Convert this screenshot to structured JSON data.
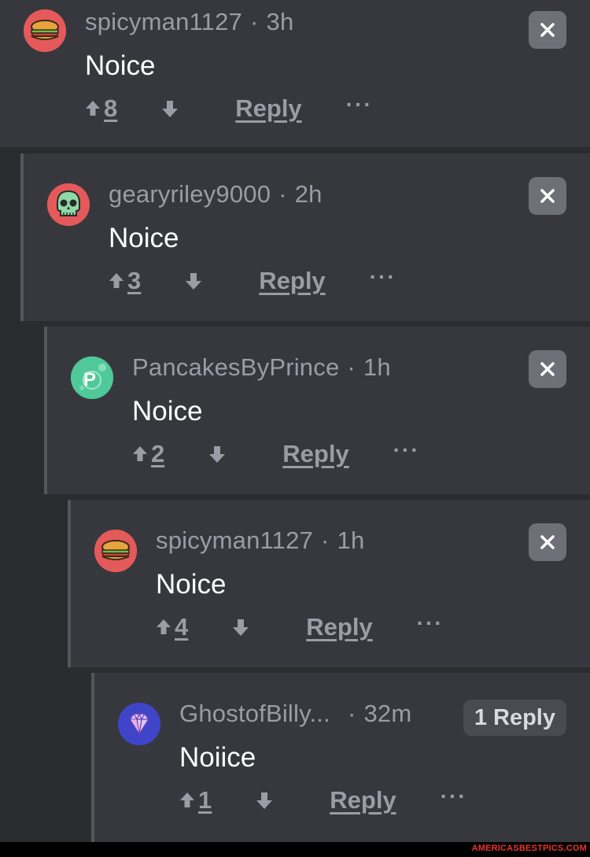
{
  "comments": [
    {
      "username": "spicyman1127",
      "time": "3h",
      "text": "Noice",
      "votes": "8",
      "reply_label": "Reply",
      "more_label": "···",
      "avatar": "sandwich-avatar",
      "avatar_bg": "#e45a5a"
    },
    {
      "username": "gearyriley9000",
      "time": "2h",
      "text": "Noice",
      "votes": "3",
      "reply_label": "Reply",
      "more_label": "···",
      "avatar": "skull-avatar",
      "avatar_bg": "#e45a5a"
    },
    {
      "username": "PancakesByPrince",
      "time": "1h",
      "text": "Noice",
      "votes": "2",
      "reply_label": "Reply",
      "more_label": "···",
      "avatar": "letter-p-avatar",
      "avatar_letter": "P",
      "avatar_bg": "#4fc99a"
    },
    {
      "username": "spicyman1127",
      "time": "1h",
      "text": "Noice",
      "votes": "4",
      "reply_label": "Reply",
      "more_label": "···",
      "avatar": "sandwich-avatar",
      "avatar_bg": "#e45a5a"
    },
    {
      "username": "GhostofBilly...",
      "time": "32m",
      "text": "Noiice",
      "votes": "1",
      "reply_label": "Reply",
      "more_label": "···",
      "replies_badge": "1 Reply",
      "avatar": "diamond-avatar",
      "avatar_bg": "#3f45c9"
    }
  ],
  "watermark": "AMERICASBESTPICS.COM",
  "colors": {
    "background": "#2b2c30",
    "card": "#37383d",
    "muted_text": "#9a9ca6",
    "close_button": "#6e7077",
    "watermark": "#e8352b"
  }
}
